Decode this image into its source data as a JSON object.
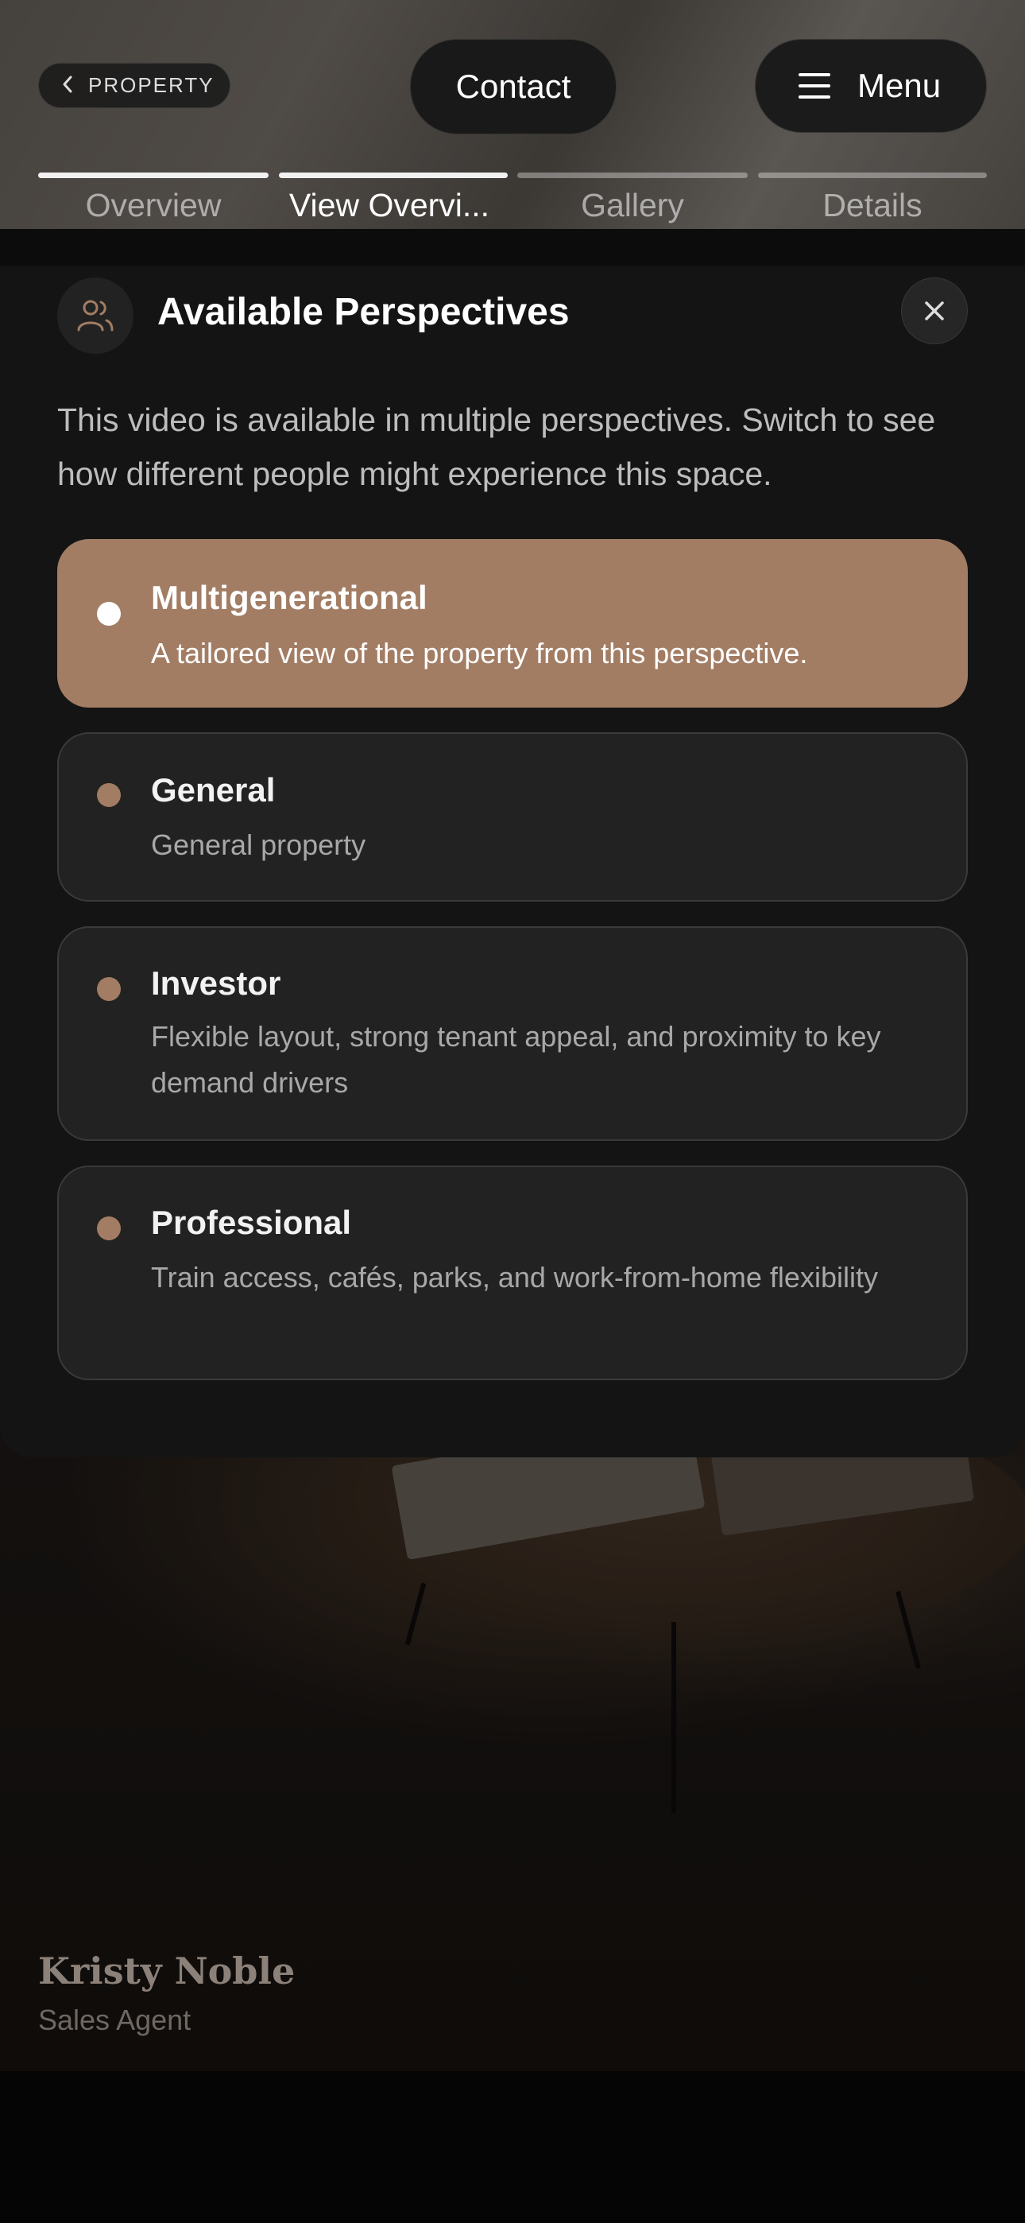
{
  "header": {
    "back_label": "PROPERTY",
    "contact_label": "Contact",
    "menu_label": "Menu"
  },
  "tabs": [
    {
      "label": "Overview",
      "progress": 1.0,
      "active": false
    },
    {
      "label": "View Overvi...",
      "progress": 1.0,
      "active": true
    },
    {
      "label": "Gallery",
      "progress": 0.0,
      "active": false
    },
    {
      "label": "Details",
      "progress": 0.0,
      "active": false
    }
  ],
  "modal": {
    "title": "Available Perspectives",
    "description": "This video is available in multiple perspectives. Switch to see how different people might experience this space.",
    "options": [
      {
        "title": "Multigenerational",
        "subtitle": "A tailored view of the property from this perspective.",
        "selected": true
      },
      {
        "title": "General",
        "subtitle": "General property",
        "selected": false
      },
      {
        "title": "Investor",
        "subtitle": "Flexible layout, strong tenant appeal, and proximity to key demand drivers",
        "selected": false
      },
      {
        "title": "Professional",
        "subtitle": "Train access, cafés, parks, and work-from-home flexibility",
        "selected": false
      }
    ]
  },
  "agent": {
    "name": "Kristy Noble",
    "role": "Sales Agent"
  },
  "colors": {
    "accent": "#a27d64",
    "modal_bg": "#141414",
    "card_bg": "#222222"
  },
  "icons": [
    "chevron-left-icon",
    "hamburger-icon",
    "people-icon",
    "close-icon"
  ]
}
